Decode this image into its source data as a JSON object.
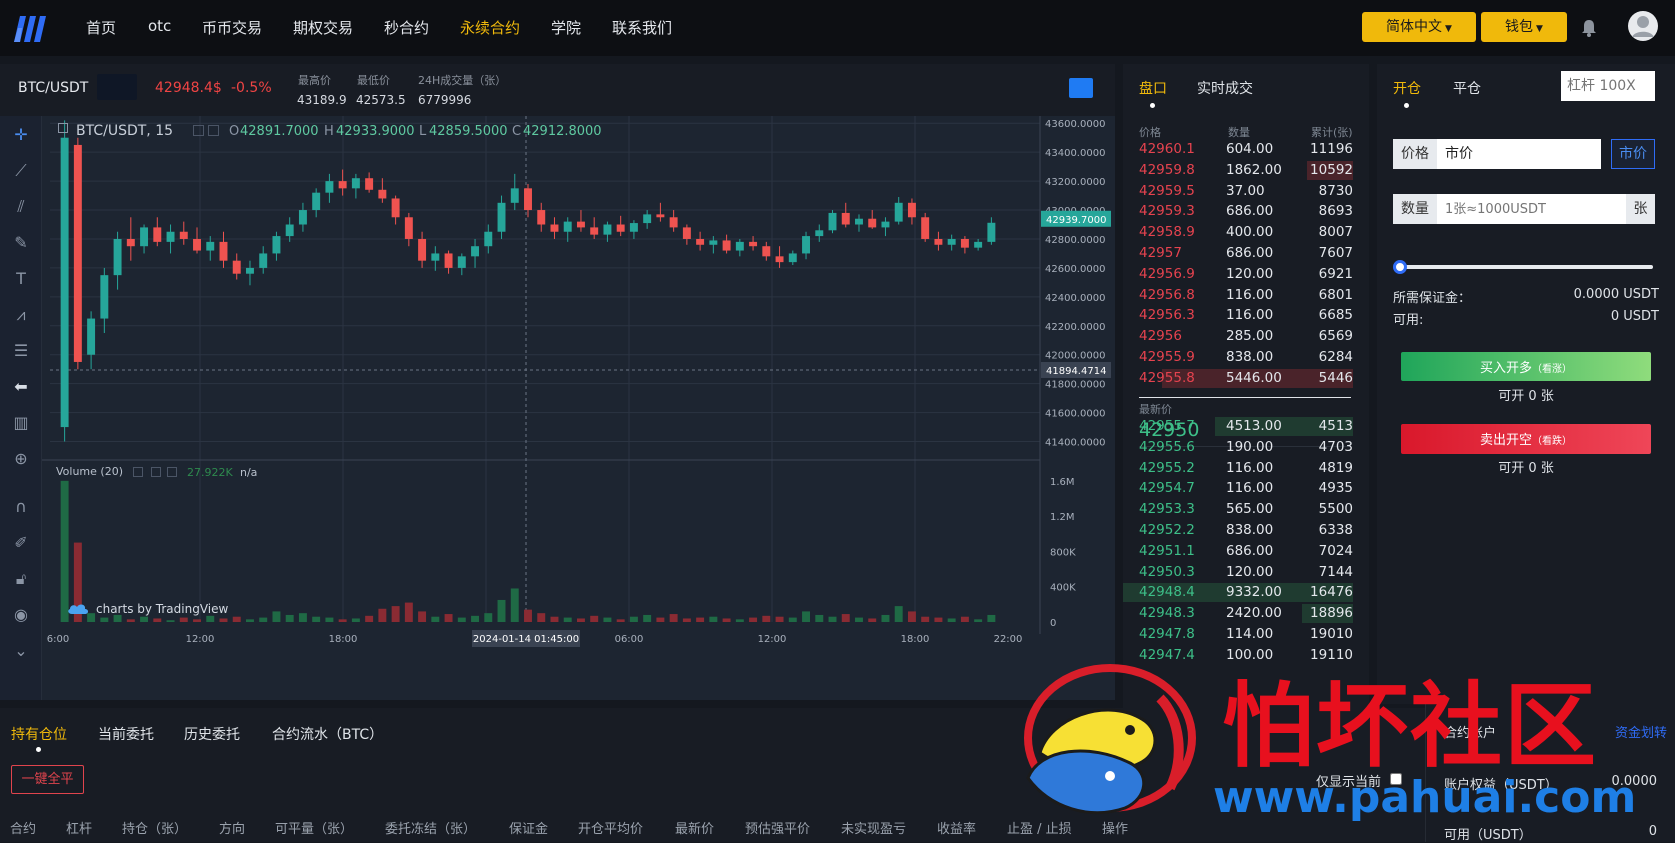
{
  "nav": {
    "items": [
      "首页",
      "otc",
      "币币交易",
      "期权交易",
      "秒合约",
      "永续合约",
      "学院",
      "联系我们"
    ],
    "active_index": 5,
    "lang_label": "简体中文",
    "wallet_label": "钱包"
  },
  "ticker": {
    "pair": "BTC/USDT",
    "price": "42948.4$",
    "change": "-0.5%",
    "high_label": "最高价",
    "high": "43189.9",
    "low_label": "最低价",
    "low": "42573.5",
    "vol_label": "24H成交量（张）",
    "vol": "6779996"
  },
  "chart": {
    "legend_symbol": "BTC/USDT, 15",
    "o": "42891.7000",
    "h": "42933.9000",
    "l": "42859.5000",
    "c": "42912.8000",
    "price_ticks": [
      "43600.0000",
      "43400.0000",
      "43200.0000",
      "43000.0000",
      "42800.0000",
      "42600.0000",
      "42400.0000",
      "42200.0000",
      "42000.0000",
      "41800.0000",
      "41600.0000",
      "41400.0000"
    ],
    "last_price_tag": "42939.7000",
    "crosshair_price_tag": "41894.4714",
    "volume_label": "Volume (20)",
    "volume_value": "27.922K",
    "volume_na": "n/a",
    "volume_ticks": [
      "1.6M",
      "1.2M",
      "800K",
      "400K",
      "0"
    ],
    "time_ticks": [
      "6:00",
      "12:00",
      "18:00",
      "06:00",
      "12:00",
      "18:00",
      "22:00"
    ],
    "crosshair_time": "2024-01-14 01:45:00",
    "attribution": "charts by TradingView",
    "up_color": "#26a69a",
    "down_color": "#ef5350"
  },
  "chart_data": {
    "type": "candlestick",
    "ylim": [
      41300,
      43650
    ],
    "series": [
      {
        "o": 41500,
        "h": 43620,
        "l": 41400,
        "c": 43500
      },
      {
        "o": 43450,
        "h": 43500,
        "l": 41900,
        "c": 41950
      },
      {
        "o": 42000,
        "h": 42300,
        "l": 41900,
        "c": 42250
      },
      {
        "o": 42250,
        "h": 42600,
        "l": 42150,
        "c": 42550
      },
      {
        "o": 42550,
        "h": 42850,
        "l": 42450,
        "c": 42800
      },
      {
        "o": 42800,
        "h": 42950,
        "l": 42650,
        "c": 42750
      },
      {
        "o": 42750,
        "h": 42900,
        "l": 42700,
        "c": 42880
      },
      {
        "o": 42880,
        "h": 42950,
        "l": 42750,
        "c": 42780
      },
      {
        "o": 42780,
        "h": 42900,
        "l": 42700,
        "c": 42850
      },
      {
        "o": 42850,
        "h": 42920,
        "l": 42760,
        "c": 42800
      },
      {
        "o": 42800,
        "h": 42880,
        "l": 42700,
        "c": 42720
      },
      {
        "o": 42720,
        "h": 42820,
        "l": 42650,
        "c": 42780
      },
      {
        "o": 42780,
        "h": 42850,
        "l": 42600,
        "c": 42650
      },
      {
        "o": 42650,
        "h": 42700,
        "l": 42520,
        "c": 42560
      },
      {
        "o": 42560,
        "h": 42650,
        "l": 42480,
        "c": 42600
      },
      {
        "o": 42600,
        "h": 42750,
        "l": 42560,
        "c": 42700
      },
      {
        "o": 42700,
        "h": 42850,
        "l": 42650,
        "c": 42820
      },
      {
        "o": 42820,
        "h": 42950,
        "l": 42780,
        "c": 42900
      },
      {
        "o": 42900,
        "h": 43050,
        "l": 42850,
        "c": 43000
      },
      {
        "o": 43000,
        "h": 43150,
        "l": 42950,
        "c": 43120
      },
      {
        "o": 43120,
        "h": 43250,
        "l": 43050,
        "c": 43200
      },
      {
        "o": 43200,
        "h": 43280,
        "l": 43100,
        "c": 43150
      },
      {
        "o": 43150,
        "h": 43250,
        "l": 43080,
        "c": 43220
      },
      {
        "o": 43220,
        "h": 43260,
        "l": 43120,
        "c": 43140
      },
      {
        "o": 43140,
        "h": 43220,
        "l": 43050,
        "c": 43080
      },
      {
        "o": 43080,
        "h": 43100,
        "l": 42900,
        "c": 42950
      },
      {
        "o": 42950,
        "h": 42980,
        "l": 42750,
        "c": 42800
      },
      {
        "o": 42800,
        "h": 42850,
        "l": 42600,
        "c": 42650
      },
      {
        "o": 42650,
        "h": 42750,
        "l": 42580,
        "c": 42700
      },
      {
        "o": 42700,
        "h": 42720,
        "l": 42560,
        "c": 42600
      },
      {
        "o": 42600,
        "h": 42700,
        "l": 42550,
        "c": 42680
      },
      {
        "o": 42680,
        "h": 42800,
        "l": 42600,
        "c": 42750
      },
      {
        "o": 42750,
        "h": 42900,
        "l": 42700,
        "c": 42850
      },
      {
        "o": 42850,
        "h": 43100,
        "l": 42800,
        "c": 43050
      },
      {
        "o": 43050,
        "h": 43250,
        "l": 43000,
        "c": 43150
      },
      {
        "o": 43150,
        "h": 43180,
        "l": 42950,
        "c": 43000
      },
      {
        "o": 43000,
        "h": 43050,
        "l": 42850,
        "c": 42900
      },
      {
        "o": 42900,
        "h": 42950,
        "l": 42800,
        "c": 42850
      },
      {
        "o": 42850,
        "h": 42950,
        "l": 42780,
        "c": 42920
      },
      {
        "o": 42920,
        "h": 43000,
        "l": 42850,
        "c": 42880
      },
      {
        "o": 42880,
        "h": 42950,
        "l": 42800,
        "c": 42830
      },
      {
        "o": 42830,
        "h": 42920,
        "l": 42780,
        "c": 42900
      },
      {
        "o": 42900,
        "h": 42960,
        "l": 42820,
        "c": 42850
      },
      {
        "o": 42850,
        "h": 42930,
        "l": 42800,
        "c": 42910
      },
      {
        "o": 42910,
        "h": 43000,
        "l": 42870,
        "c": 42970
      },
      {
        "o": 42970,
        "h": 43050,
        "l": 42920,
        "c": 42950
      },
      {
        "o": 42950,
        "h": 43000,
        "l": 42850,
        "c": 42880
      },
      {
        "o": 42880,
        "h": 42900,
        "l": 42760,
        "c": 42800
      },
      {
        "o": 42800,
        "h": 42850,
        "l": 42720,
        "c": 42760
      },
      {
        "o": 42760,
        "h": 42820,
        "l": 42700,
        "c": 42790
      },
      {
        "o": 42790,
        "h": 42830,
        "l": 42700,
        "c": 42720
      },
      {
        "o": 42720,
        "h": 42800,
        "l": 42680,
        "c": 42780
      },
      {
        "o": 42780,
        "h": 42820,
        "l": 42720,
        "c": 42750
      },
      {
        "o": 42750,
        "h": 42780,
        "l": 42650,
        "c": 42680
      },
      {
        "o": 42680,
        "h": 42750,
        "l": 42600,
        "c": 42640
      },
      {
        "o": 42640,
        "h": 42720,
        "l": 42620,
        "c": 42700
      },
      {
        "o": 42700,
        "h": 42850,
        "l": 42660,
        "c": 42820
      },
      {
        "o": 42820,
        "h": 42900,
        "l": 42780,
        "c": 42860
      },
      {
        "o": 42860,
        "h": 43000,
        "l": 42840,
        "c": 42980
      },
      {
        "o": 42980,
        "h": 43050,
        "l": 42880,
        "c": 42900
      },
      {
        "o": 42900,
        "h": 42970,
        "l": 42850,
        "c": 42940
      },
      {
        "o": 42940,
        "h": 43000,
        "l": 42870,
        "c": 42880
      },
      {
        "o": 42880,
        "h": 42950,
        "l": 42820,
        "c": 42920
      },
      {
        "o": 42920,
        "h": 43090,
        "l": 42900,
        "c": 43050
      },
      {
        "o": 43050,
        "h": 43080,
        "l": 42900,
        "c": 42950
      },
      {
        "o": 42950,
        "h": 42980,
        "l": 42780,
        "c": 42800
      },
      {
        "o": 42800,
        "h": 42850,
        "l": 42720,
        "c": 42760
      },
      {
        "o": 42760,
        "h": 42830,
        "l": 42720,
        "c": 42800
      },
      {
        "o": 42800,
        "h": 42820,
        "l": 42700,
        "c": 42740
      },
      {
        "o": 42740,
        "h": 42800,
        "l": 42720,
        "c": 42780
      },
      {
        "o": 42780,
        "h": 42950,
        "l": 42760,
        "c": 42912
      }
    ],
    "volumes": [
      1.6,
      0.9,
      0.1,
      0.05,
      0.08,
      0.03,
      0.06,
      0.04,
      0.02,
      0.05,
      0.03,
      0.07,
      0.04,
      0.06,
      0.03,
      0.05,
      0.12,
      0.08,
      0.1,
      0.06,
      0.05,
      0.03,
      0.04,
      0.07,
      0.15,
      0.18,
      0.22,
      0.12,
      0.06,
      0.09,
      0.05,
      0.07,
      0.1,
      0.25,
      0.38,
      0.14,
      0.1,
      0.06,
      0.05,
      0.04,
      0.07,
      0.05,
      0.03,
      0.06,
      0.08,
      0.05,
      0.09,
      0.04,
      0.05,
      0.06,
      0.04,
      0.03,
      0.05,
      0.07,
      0.06,
      0.05,
      0.12,
      0.08,
      0.06,
      0.09,
      0.05,
      0.04,
      0.08,
      0.18,
      0.12,
      0.06,
      0.05,
      0.04,
      0.06,
      0.03,
      0.08
    ],
    "vlim": [
      0,
      1.7
    ]
  },
  "orderbook": {
    "tab_book": "盘口",
    "tab_trades": "实时成交",
    "col_price": "价格",
    "col_qty": "数量",
    "col_total": "累计(张)",
    "asks": [
      {
        "price": "42960.1",
        "qty": "604.00",
        "total": "11196",
        "depth": 0.0
      },
      {
        "price": "42959.8",
        "qty": "1862.00",
        "total": "10592",
        "depth": 0.2
      },
      {
        "price": "42959.5",
        "qty": "37.00",
        "total": "8730",
        "depth": 0.0
      },
      {
        "price": "42959.3",
        "qty": "686.00",
        "total": "8693",
        "depth": 0.0
      },
      {
        "price": "42958.9",
        "qty": "400.00",
        "total": "8007",
        "depth": 0.0
      },
      {
        "price": "42957",
        "qty": "686.00",
        "total": "7607",
        "depth": 0.0
      },
      {
        "price": "42956.9",
        "qty": "120.00",
        "total": "6921",
        "depth": 0.0
      },
      {
        "price": "42956.8",
        "qty": "116.00",
        "total": "6801",
        "depth": 0.0
      },
      {
        "price": "42956.3",
        "qty": "116.00",
        "total": "6685",
        "depth": 0.0
      },
      {
        "price": "42956",
        "qty": "285.00",
        "total": "6569",
        "depth": 0.0
      },
      {
        "price": "42955.9",
        "qty": "838.00",
        "total": "6284",
        "depth": 0.0
      },
      {
        "price": "42955.8",
        "qty": "5446.00",
        "total": "5446",
        "depth": 0.83
      }
    ],
    "latest_label": "最新价",
    "latest_price": "42950",
    "bids": [
      {
        "price": "42955.7",
        "qty": "4513.00",
        "total": "4513",
        "depth": 0.6
      },
      {
        "price": "42955.6",
        "qty": "190.00",
        "total": "4703",
        "depth": 0.0
      },
      {
        "price": "42955.2",
        "qty": "116.00",
        "total": "4819",
        "depth": 0.0
      },
      {
        "price": "42954.7",
        "qty": "116.00",
        "total": "4935",
        "depth": 0.0
      },
      {
        "price": "42953.3",
        "qty": "565.00",
        "total": "5500",
        "depth": 0.0
      },
      {
        "price": "42952.2",
        "qty": "838.00",
        "total": "6338",
        "depth": 0.0
      },
      {
        "price": "42951.1",
        "qty": "686.00",
        "total": "7024",
        "depth": 0.0
      },
      {
        "price": "42950.3",
        "qty": "120.00",
        "total": "7144",
        "depth": 0.0
      },
      {
        "price": "42948.4",
        "qty": "9332.00",
        "total": "16476",
        "depth": 1.0
      },
      {
        "price": "42948.3",
        "qty": "2420.00",
        "total": "18896",
        "depth": 0.22
      },
      {
        "price": "42947.8",
        "qty": "114.00",
        "total": "19010",
        "depth": 0.0
      },
      {
        "price": "42947.4",
        "qty": "100.00",
        "total": "19110",
        "depth": 0.0
      }
    ]
  },
  "trade": {
    "tab_open": "开仓",
    "tab_close": "平仓",
    "leverage_placeholder": "杠杆 100X",
    "price_label": "价格",
    "price_value": "市价",
    "market_button": "市价",
    "qty_label": "数量",
    "qty_placeholder": "1张≈1000USDT",
    "qty_unit": "张",
    "slider_percent": 0,
    "margin_label": "所需保证金：",
    "margin_value": "0.0000 USDT",
    "available_label": "可用:",
    "available_value": "0 USDT",
    "buy_label": "买入开多",
    "buy_sub": "（看涨）",
    "buy_avail": "可开 0 张",
    "sell_label": "卖出开空",
    "sell_sub": "（看跌）",
    "sell_avail": "可开 0 张"
  },
  "bottom": {
    "tabs": [
      "持有仓位",
      "当前委托",
      "历史委托",
      "合约流水（BTC）"
    ],
    "close_all": "一键全平",
    "only_current": "仅显示当前",
    "columns": [
      "合约",
      "杠杆",
      "持仓（张）",
      "方向",
      "可平量（张）",
      "委托冻结（张）",
      "保证金",
      "开仓平均价",
      "最新价",
      "预估强平价",
      "未实现盈亏",
      "收益率",
      "止盈 / 止损",
      "操作"
    ]
  },
  "account": {
    "title": "合约账户",
    "transfer": "资金划转",
    "equity_label": "账户权益（USDT）",
    "equity_value": "0.0000",
    "avail_label": "可用（USDT）",
    "avail_value": "0"
  },
  "watermark": {
    "title": "怕坏社区",
    "url": "www.pahuai.com"
  }
}
